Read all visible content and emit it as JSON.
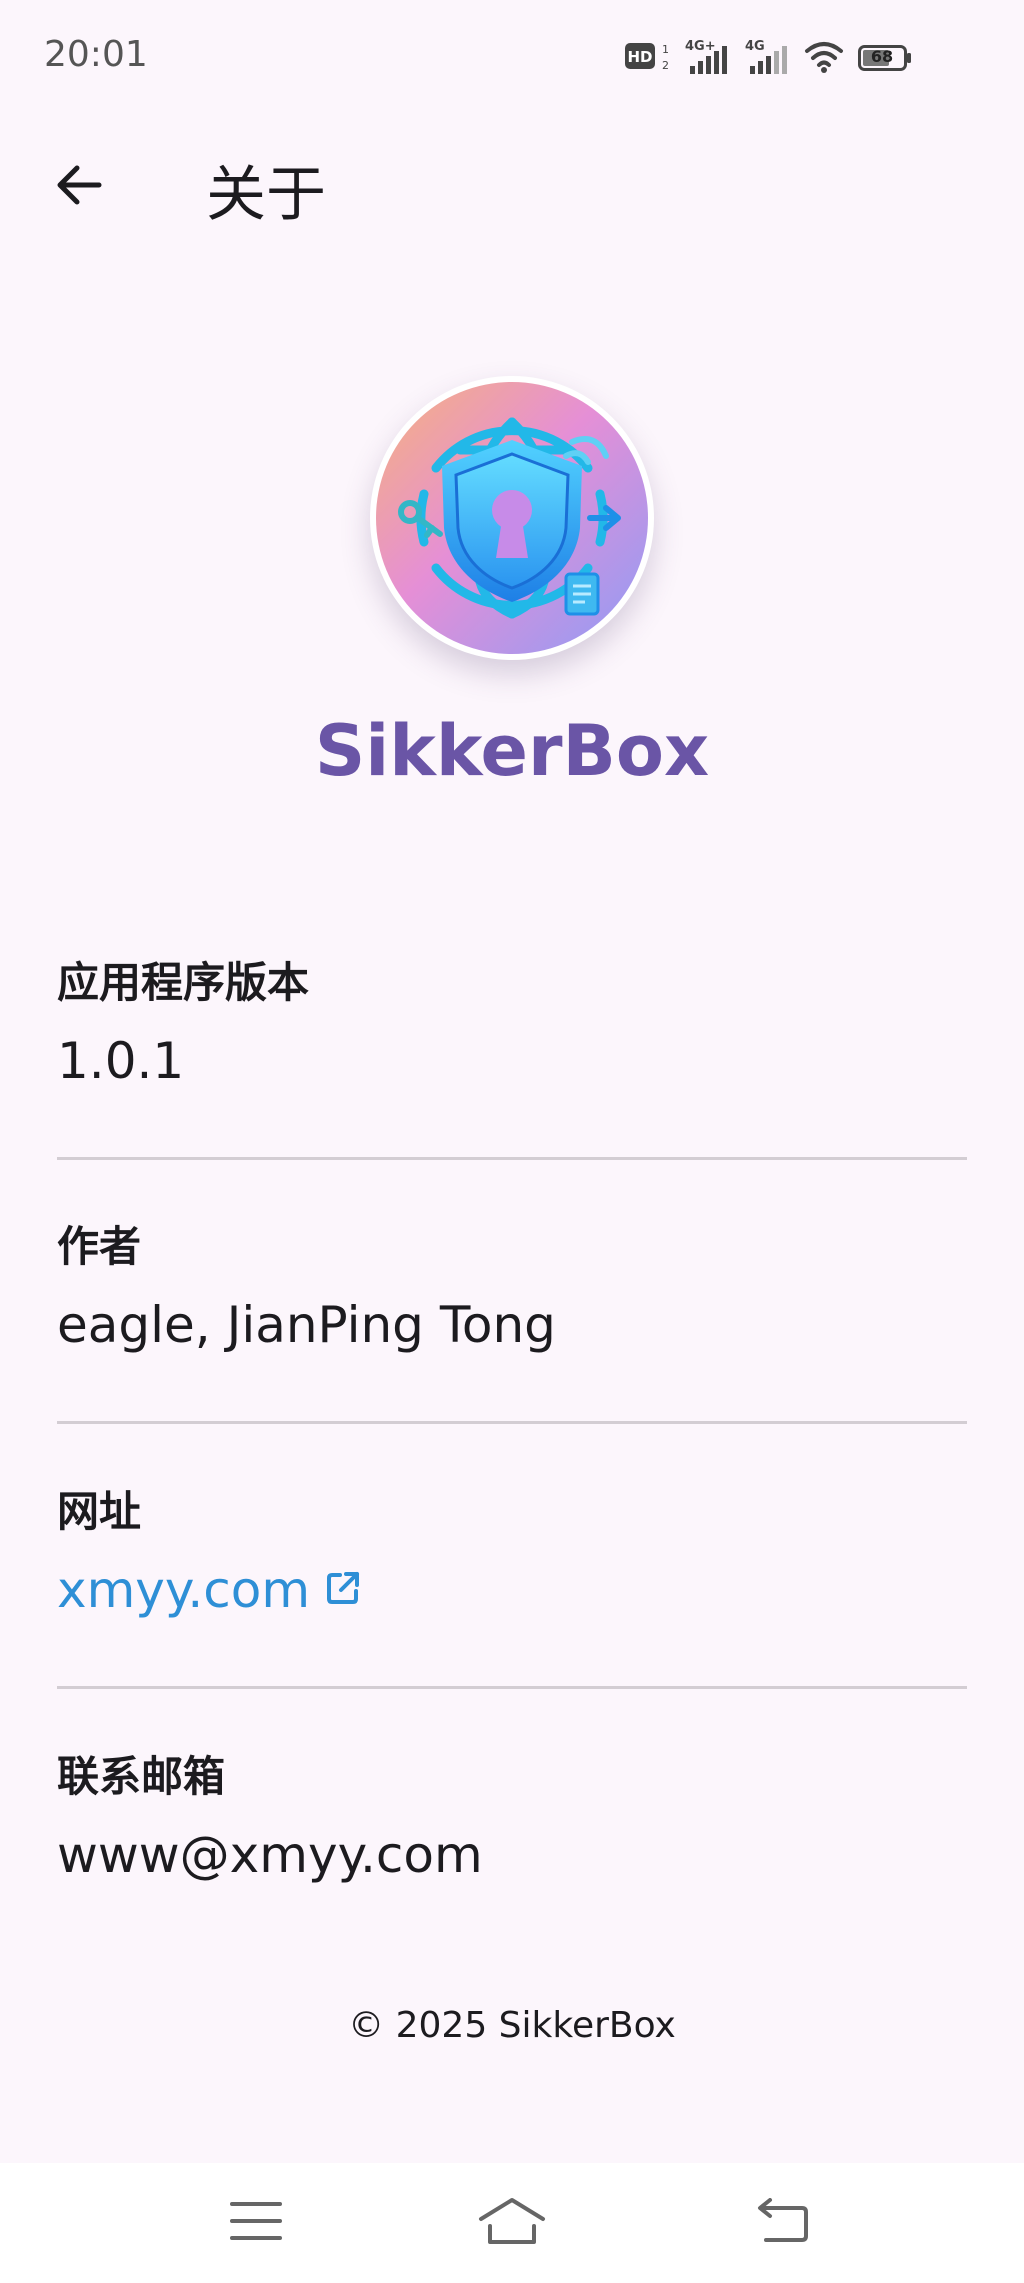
{
  "status_bar": {
    "time": "20:01",
    "battery_level": "68",
    "network_labels": [
      "HD",
      "4G+",
      "4G"
    ],
    "icons": [
      "hd-icon",
      "signal-4g-plus-icon",
      "signal-4g-icon",
      "wifi-icon",
      "battery-icon"
    ]
  },
  "app_bar": {
    "title": "关于",
    "back_icon": "arrow-left-icon"
  },
  "app": {
    "name": "SikkerBox",
    "logo_icon": "shield-keyhole-globe-logo"
  },
  "info": {
    "version_label": "应用程序版本",
    "version_value": "1.0.1",
    "author_label": "作者",
    "author_value": "eagle, JianPing Tong",
    "website_label": "网址",
    "website_value": "xmyy.com",
    "website_icon": "external-link-icon",
    "email_label": "联系邮箱",
    "email_value": "www@xmyy.com"
  },
  "footer": {
    "copyright": "© 2025 SikkerBox"
  },
  "nav_bar": {
    "icons": [
      "menu-icon",
      "home-icon",
      "back-icon"
    ]
  },
  "colors": {
    "background": "#FCF6FC",
    "accent": "#6A55A6",
    "link": "#2E8FD6",
    "divider": "#D3CDD3"
  }
}
